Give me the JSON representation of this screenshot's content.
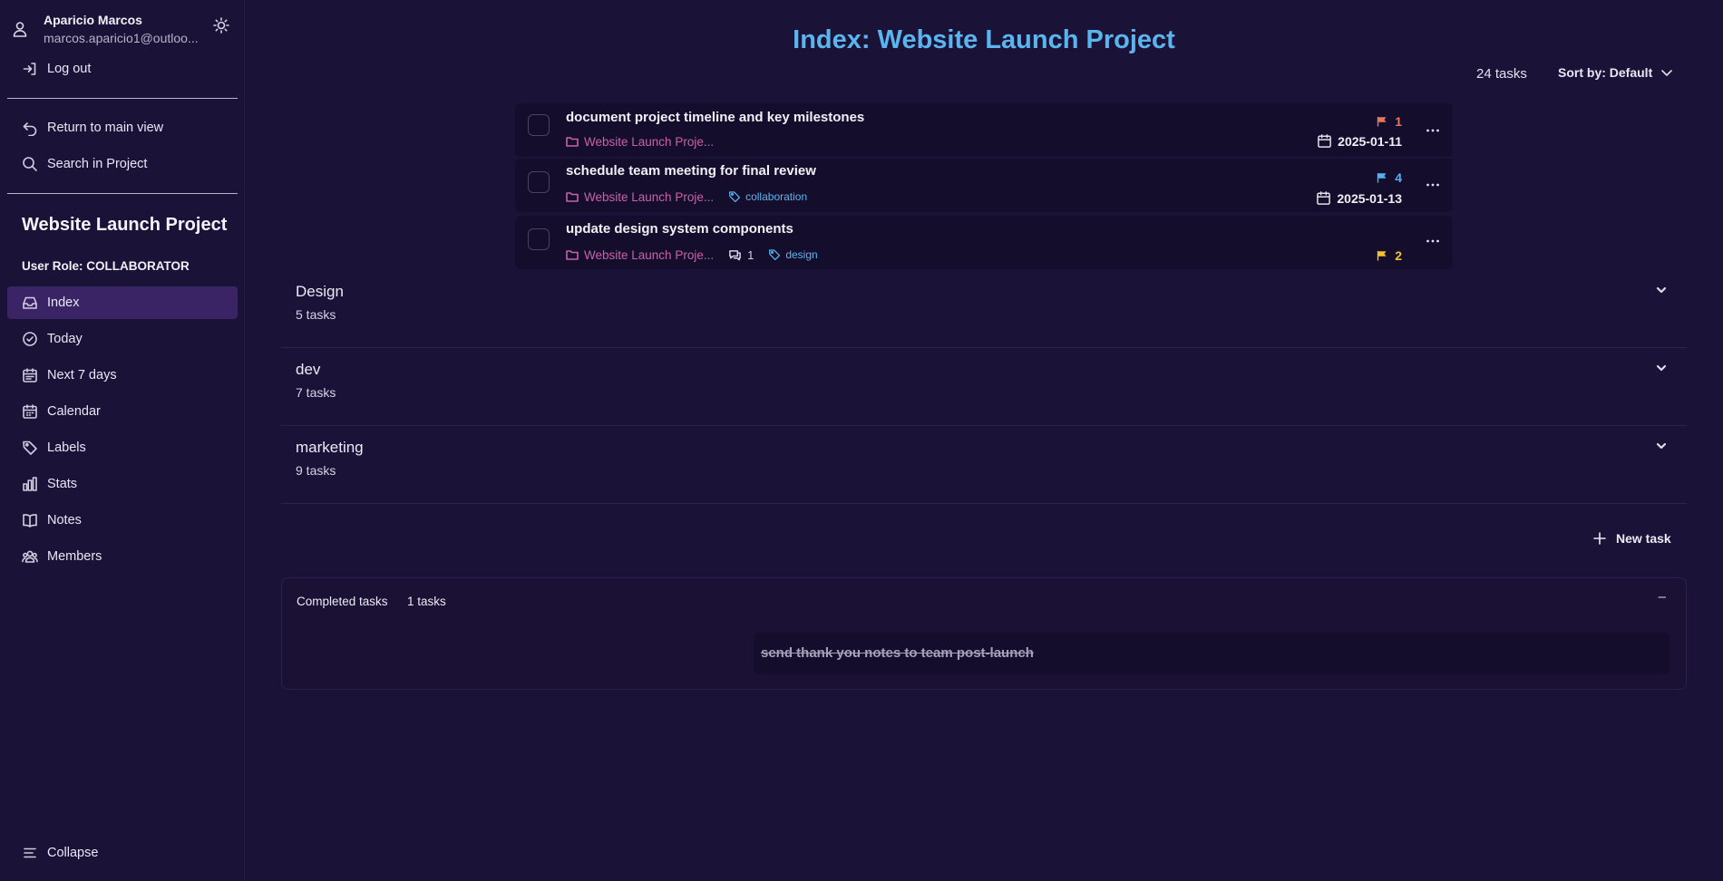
{
  "user": {
    "name": "Aparicio Marcos",
    "email": "marcos.aparicio1@outloo..."
  },
  "account": {
    "logout_label": "Log out"
  },
  "project_nav": {
    "return_label": "Return to main view",
    "search_label": "Search in Project"
  },
  "project": {
    "name": "Website Launch Project",
    "role_line": "User Role: COLLABORATOR"
  },
  "nav": {
    "items": [
      {
        "label": "Index",
        "icon": "inbox-icon",
        "active": true
      },
      {
        "label": "Today",
        "icon": "check-circle-icon"
      },
      {
        "label": "Next 7 days",
        "icon": "calendar-week-icon"
      },
      {
        "label": "Calendar",
        "icon": "calendar-icon"
      },
      {
        "label": "Labels",
        "icon": "tag-icon"
      },
      {
        "label": "Stats",
        "icon": "bar-chart-icon"
      },
      {
        "label": "Notes",
        "icon": "book-icon"
      },
      {
        "label": "Members",
        "icon": "users-icon"
      }
    ],
    "collapse_label": "Collapse"
  },
  "main": {
    "title": "Index: Website Launch Project",
    "task_count": "24 tasks",
    "sort_label": "Sort by: Default",
    "new_task_label": "New task"
  },
  "tasks": [
    {
      "title": "document project timeline and key milestones",
      "project": "Website Launch Proje...",
      "priority": "1",
      "priority_color": "#e8785a",
      "due": "2025-01-11"
    },
    {
      "title": "schedule team meeting for final review",
      "project": "Website Launch Proje...",
      "label": "collaboration",
      "priority": "4",
      "priority_color": "#4fb3f0",
      "due": "2025-01-13"
    },
    {
      "title": "update design system components",
      "project": "Website Launch Proje...",
      "comments": "1",
      "label": "design",
      "priority": "2",
      "priority_color": "#f0c232"
    }
  ],
  "sections": [
    {
      "name": "Design",
      "count": "5 tasks"
    },
    {
      "name": "dev",
      "count": "7 tasks"
    },
    {
      "name": "marketing",
      "count": "9 tasks"
    }
  ],
  "completed": {
    "label": "Completed tasks",
    "count": "1 tasks",
    "toggle": "–",
    "tasks": [
      {
        "title": "send thank you notes to team post-launch"
      }
    ]
  },
  "colors": {
    "background": "#1b1238",
    "accent": "#5ab5ee",
    "active_nav": "#3a2466",
    "project_link": "#c862a8"
  }
}
